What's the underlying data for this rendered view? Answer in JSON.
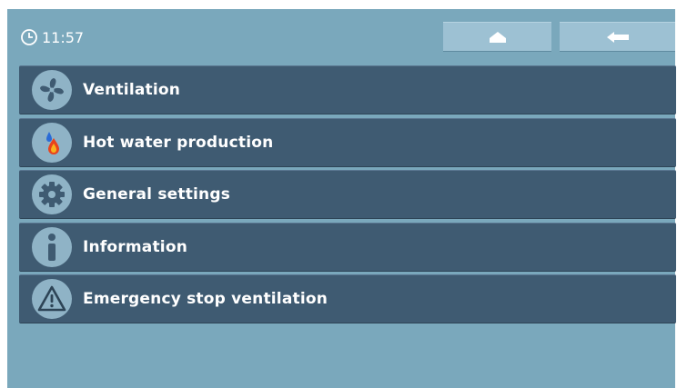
{
  "status": {
    "time": "11:57"
  },
  "nav": {
    "home_icon": "home-icon",
    "back_icon": "back-arrow-icon"
  },
  "menu": {
    "items": [
      {
        "label": "Ventilation",
        "icon": "fan-icon"
      },
      {
        "label": "Hot water production",
        "icon": "hot-water-icon"
      },
      {
        "label": "General settings",
        "icon": "gear-icon"
      },
      {
        "label": "Information",
        "icon": "info-icon"
      },
      {
        "label": "Emergency stop ventilation",
        "icon": "warning-icon"
      }
    ]
  },
  "colors": {
    "background": "#7aa8bc",
    "menu_item": "#3f5b72",
    "nav_button": "#9dc1d3",
    "icon_circle": "#8fb3c6",
    "text": "#ffffff"
  }
}
